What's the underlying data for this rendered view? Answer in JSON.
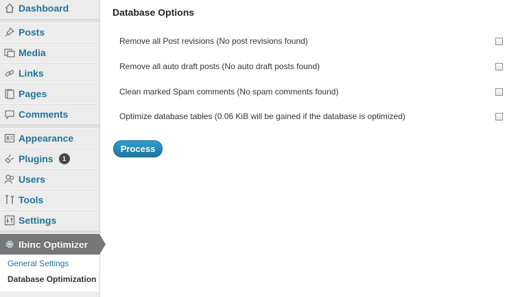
{
  "sidebar": {
    "items": [
      {
        "label": "Dashboard",
        "icon": "dashboard-icon"
      },
      {
        "label": "Posts",
        "icon": "pin-icon"
      },
      {
        "label": "Media",
        "icon": "media-icon"
      },
      {
        "label": "Links",
        "icon": "link-icon"
      },
      {
        "label": "Pages",
        "icon": "pages-icon"
      },
      {
        "label": "Comments",
        "icon": "comment-icon"
      },
      {
        "label": "Appearance",
        "icon": "appearance-icon"
      },
      {
        "label": "Plugins",
        "icon": "plugin-icon",
        "badge": "1"
      },
      {
        "label": "Users",
        "icon": "users-icon"
      },
      {
        "label": "Tools",
        "icon": "tools-icon"
      },
      {
        "label": "Settings",
        "icon": "settings-icon"
      }
    ],
    "active": {
      "label": "Ibinc Optimizer",
      "icon": "gear-icon"
    },
    "submenu": [
      "General Settings",
      "Database Optimization"
    ]
  },
  "main": {
    "title": "Database Options",
    "options": [
      "Remove all Post revisions (No post revisions found)",
      "Remove all auto draft posts (No auto draft posts found)",
      "Clean marked Spam comments (No spam comments found)",
      "Optimize database tables (0.06 KiB will be gained if the database is optimized)"
    ],
    "process_label": "Process"
  },
  "colors": {
    "link": "#21759b",
    "active_bg": "#777777",
    "sidebar_bg": "#ececec",
    "button": "#21759b"
  }
}
